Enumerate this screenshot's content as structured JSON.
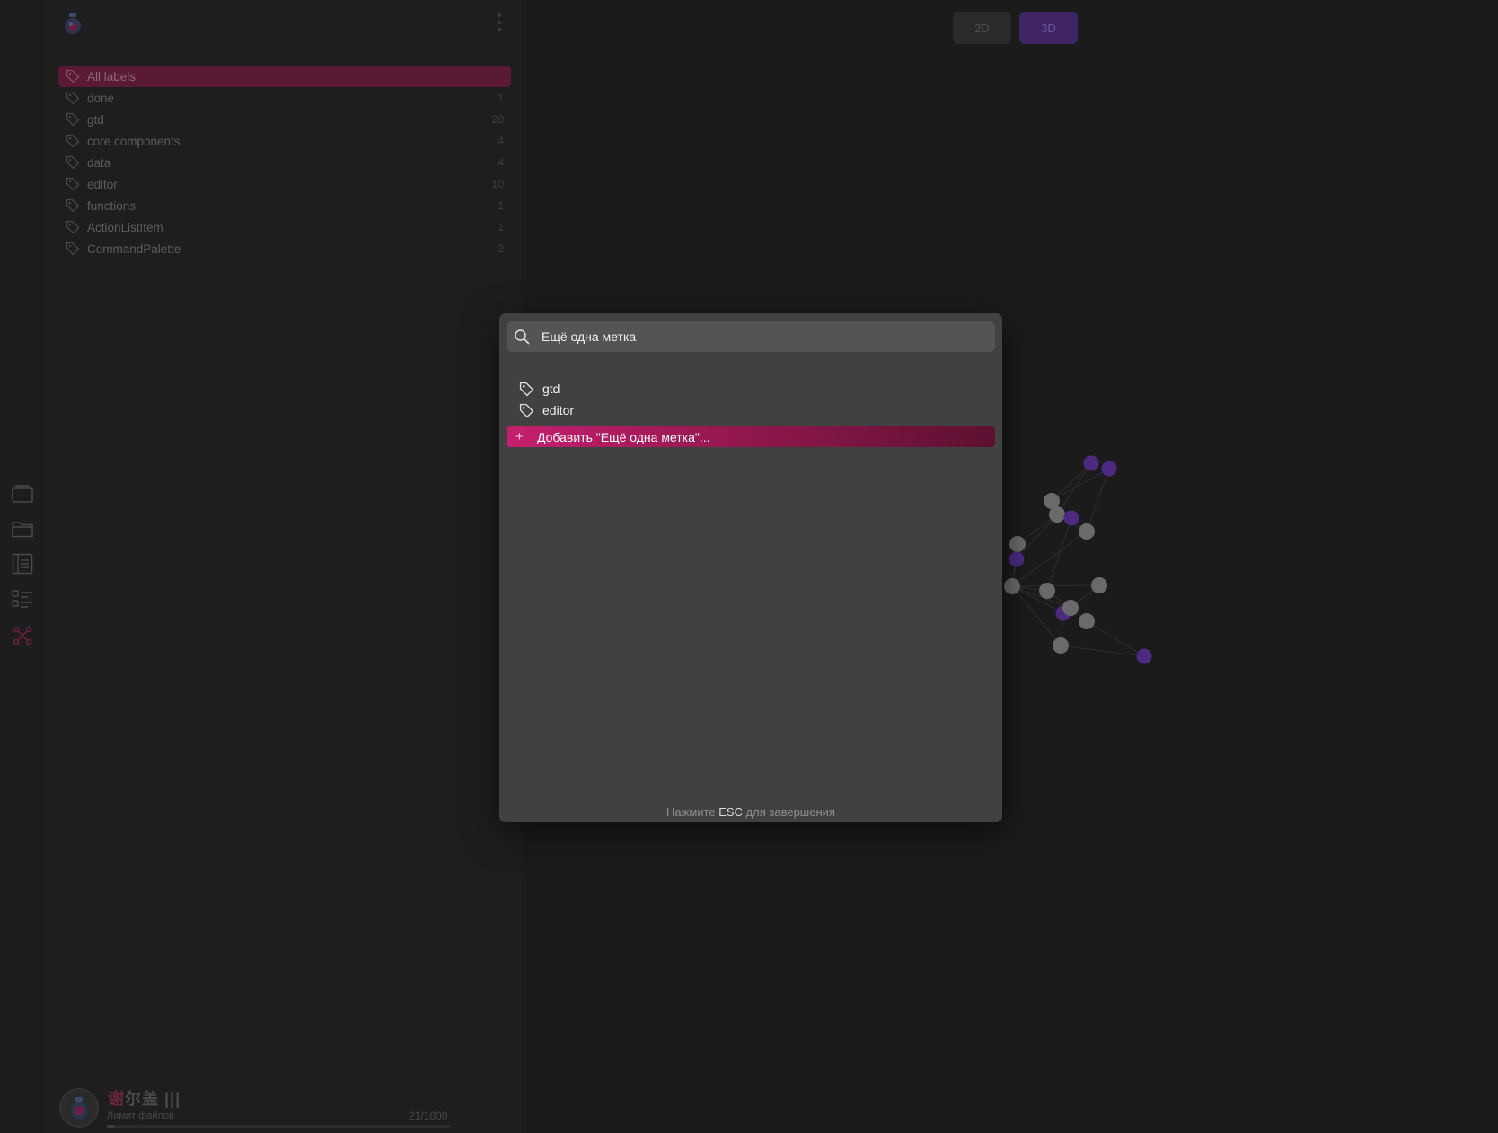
{
  "view_toggle": {
    "btn_2d": "2D",
    "btn_3d": "3D",
    "active": "3D"
  },
  "labels": {
    "items": [
      {
        "name": "All labels",
        "count": "",
        "active": true
      },
      {
        "name": "done",
        "count": "1"
      },
      {
        "name": "gtd",
        "count": "20"
      },
      {
        "name": "core components",
        "count": "4"
      },
      {
        "name": "data",
        "count": "4"
      },
      {
        "name": "editor",
        "count": "10"
      },
      {
        "name": "functions",
        "count": "1"
      },
      {
        "name": "ActionListItem",
        "count": "1"
      },
      {
        "name": "CommandPalette",
        "count": "2"
      }
    ]
  },
  "rail": {
    "icons": [
      "inbox-icon",
      "folder-icon",
      "notes-list-icon",
      "checklist-icon",
      "graph-icon"
    ]
  },
  "footer": {
    "name_accent": "谢",
    "name_rest": "尔盖 |||",
    "limit_label": "Лимит файлов",
    "limit_count": "21/1000",
    "limit_fraction": 0.021
  },
  "modal": {
    "search_value": "Ещё одна метка",
    "suggestions": [
      "gtd",
      "editor"
    ],
    "add_label": "Добавить \"Ещё одна метка\"...",
    "hint_prefix": "Нажмите",
    "hint_key": "ESC",
    "hint_suffix": "для завершения"
  },
  "colors": {
    "accent": "#c51f6e",
    "graph_node": "#6a6a6a",
    "graph_node_alt": "#4b2a80",
    "toggle_active": "#3e2460"
  }
}
